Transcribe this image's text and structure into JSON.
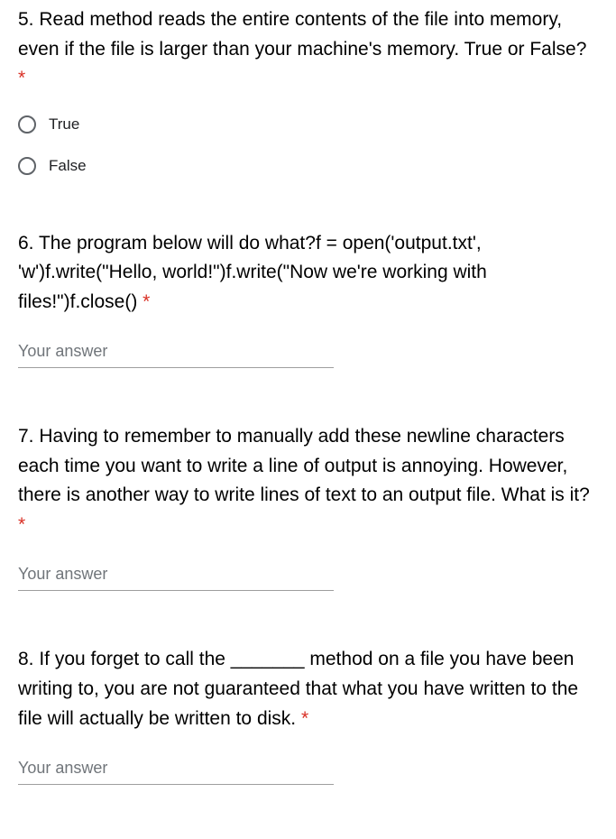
{
  "questions": [
    {
      "text": "5. Read method reads the entire contents of the file into memory, even if the file is larger than your machine's memory. True or False?",
      "required_marker": "*",
      "type": "radio",
      "options": [
        "True",
        "False"
      ],
      "placeholder": ""
    },
    {
      "text": "6. The program below will do what?f = open('output.txt', 'w')f.write(\"Hello, world!\")f.write(\"Now we're working with files!\")f.close()",
      "required_marker": "*",
      "type": "text",
      "placeholder": "Your answer"
    },
    {
      "text": "7. Having to remember to manually add these newline characters each time you want to write a line of output is annoying. However, there is another way to write lines of text to an output file. What is it?",
      "required_marker": "*",
      "type": "text",
      "placeholder": "Your answer"
    },
    {
      "text": "8. If you forget to call the _______ method on a file you have been writing to, you are not guaranteed that what you have written to the file will actually be written to disk.",
      "required_marker": "*",
      "type": "text",
      "placeholder": "Your answer"
    }
  ]
}
